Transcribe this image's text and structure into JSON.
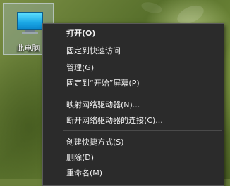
{
  "desktop_icon": {
    "label": "此电脑"
  },
  "context_menu": {
    "items": [
      {
        "label": "打开(O)"
      },
      {
        "label": "固定到快速访问"
      },
      {
        "label": "管理(G)"
      },
      {
        "label": "固定到“开始”屏幕(P)"
      },
      {
        "label": "映射网络驱动器(N)..."
      },
      {
        "label": "断开网络驱动器的连接(C)..."
      },
      {
        "label": "创建快捷方式(S)"
      },
      {
        "label": "删除(D)"
      },
      {
        "label": "重命名(M)"
      }
    ]
  }
}
